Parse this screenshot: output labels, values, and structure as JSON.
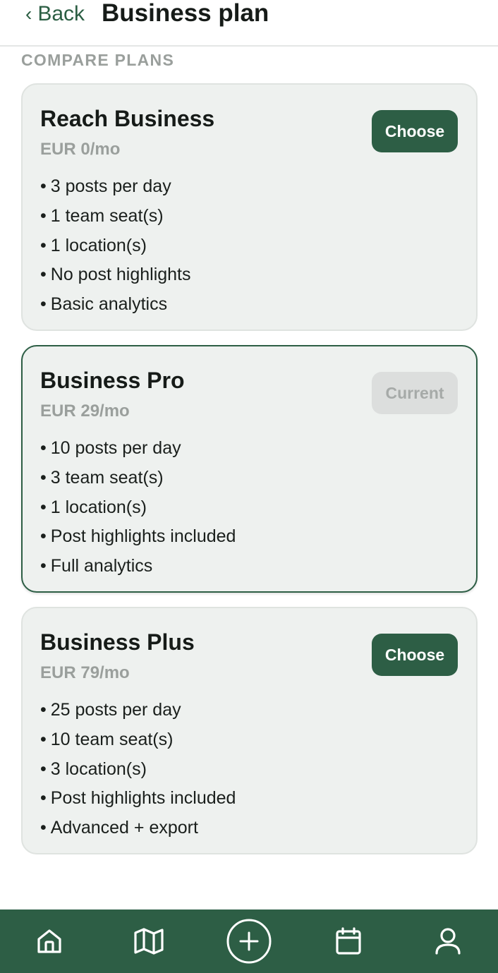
{
  "header": {
    "back_label": "Back",
    "back_chevron": "‹",
    "title": "Business plan"
  },
  "section_label": "COMPARE PLANS",
  "plans": [
    {
      "name": "Reach Business",
      "price": "EUR 0/mo",
      "button": "Choose",
      "is_current": false,
      "features": [
        "3 posts per day",
        "1 team seat(s)",
        "1 location(s)",
        "No post highlights",
        "Basic analytics"
      ]
    },
    {
      "name": "Business Pro",
      "price": "EUR 29/mo",
      "button": "Current",
      "is_current": true,
      "features": [
        "10 posts per day",
        "3 team seat(s)",
        "1 location(s)",
        "Post highlights included",
        "Full analytics"
      ]
    },
    {
      "name": "Business Plus",
      "price": "EUR 79/mo",
      "button": "Choose",
      "is_current": false,
      "features": [
        "25 posts per day",
        "10 team seat(s)",
        "3 location(s)",
        "Post highlights included",
        "Advanced + export"
      ]
    }
  ],
  "bottom_nav": [
    {
      "icon": "home-icon"
    },
    {
      "icon": "map-icon"
    },
    {
      "icon": "plus-circle-icon"
    },
    {
      "icon": "calendar-icon"
    },
    {
      "icon": "profile-icon"
    }
  ],
  "colors": {
    "accent": "#2d5e45",
    "card_bg": "#eef1ef",
    "muted_text": "#9a9f9c",
    "disabled_button_bg": "#dcdedd"
  }
}
